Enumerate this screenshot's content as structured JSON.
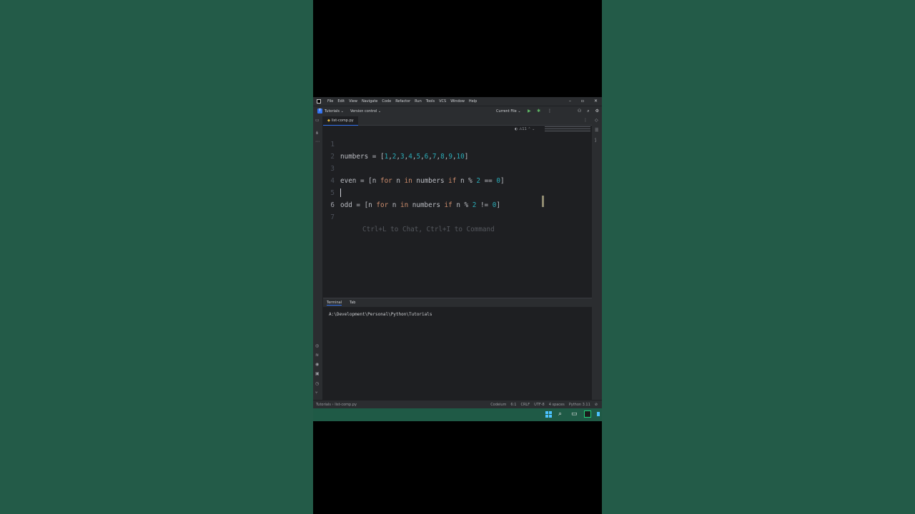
{
  "colors": {
    "background": "#235b48",
    "ide_bg": "#1e1f22",
    "panel_bg": "#2b2d30",
    "keyword": "#cf8e6d",
    "number": "#2aacb8",
    "accent": "#3574f0"
  },
  "menu": [
    "File",
    "Edit",
    "View",
    "Navigate",
    "Code",
    "Refactor",
    "Run",
    "Tools",
    "VCS",
    "Window",
    "Help"
  ],
  "toolbar": {
    "project_badge": "T",
    "project": "Tutorials ⌄",
    "version_control": "Version control ⌄",
    "run_config": "Current File ⌄"
  },
  "file_tab": "list-comp.py",
  "editor": {
    "line_numbers": [
      "1",
      "2",
      "3",
      "4",
      "5",
      "6",
      "7"
    ],
    "line1": {
      "a": "numbers = [",
      "n1": "1",
      "n2": "2",
      "n3": "3",
      "n4": "4",
      "n5": "5",
      "n6": "6",
      "n7": "7",
      "n8": "8",
      "n9": "9",
      "n10": "10",
      "close": "]"
    },
    "line3": {
      "a": "even = [n ",
      "for": "for",
      "b": " n ",
      "in": "in",
      "c": " numbers ",
      "if": "if",
      "d": " n % ",
      "n2": "2",
      "e": " == ",
      "n0": "0",
      "f": "]"
    },
    "line5": {
      "a": "odd = [n ",
      "for": "for",
      "b": " n ",
      "in": "in",
      "c": " numbers ",
      "if": "if",
      "d": " n % ",
      "n2": "2",
      "e": " != ",
      "n0": "0",
      "f": "]"
    },
    "hint": "Ctrl+L to Chat, Ctrl+I to Command"
  },
  "terminal": {
    "tabs": [
      "Terminal",
      "Tab"
    ],
    "path": "A:\\Development\\Personal\\Python\\Tutorials"
  },
  "statusbar": {
    "crumb_project": "Tutorials",
    "crumb_file": "list-comp.py",
    "codeium": "Codeium",
    "position": "6:1",
    "line_sep": "CRLF",
    "encoding": "UTF-8",
    "indent": "4 spaces",
    "interpreter": "Python 3.11"
  }
}
